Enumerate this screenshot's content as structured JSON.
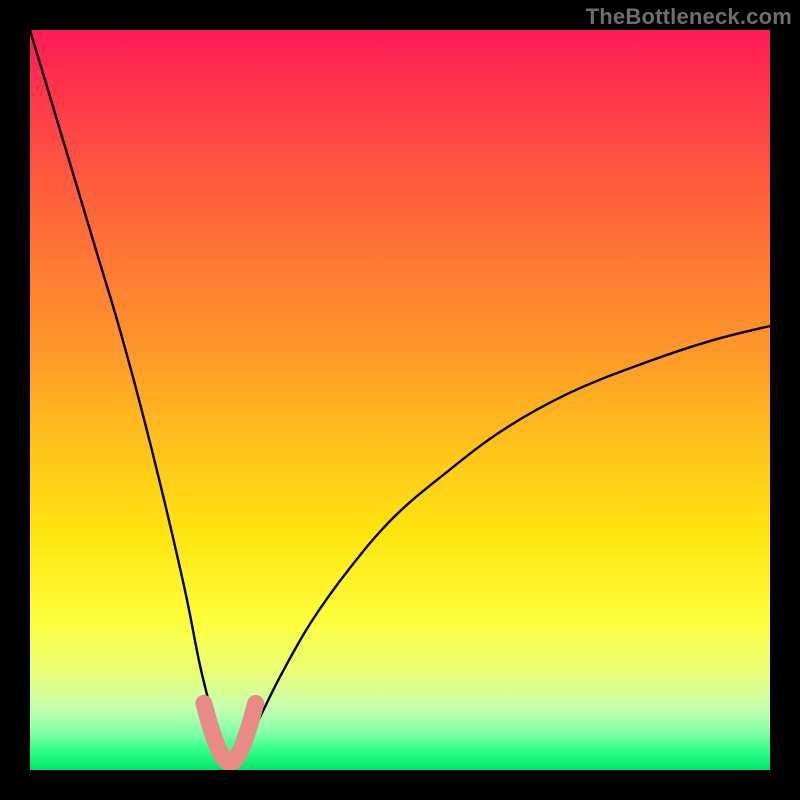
{
  "watermark": {
    "text": "TheBottleneck.com"
  },
  "colors": {
    "frame": "#000000",
    "curve": "#000000",
    "highlight": "#e98a86",
    "gradient_top": "#ff1a55",
    "gradient_bottom": "#00e66b"
  },
  "chart_data": {
    "type": "line",
    "title": "",
    "xlabel": "",
    "ylabel": "",
    "xlim": [
      0,
      100
    ],
    "ylim": [
      0,
      100
    ],
    "description": "Bottleneck curve: y ≈ |x − 27| shaped valley; minimum at x≈27 (y≈0), rising steeply to y≈100 at x≈0 and gradually to y≈60 at x≈100. Background gradient maps y≈0 → green, y≈100 → red.",
    "series": [
      {
        "name": "bottleneck-curve",
        "x": [
          0,
          3,
          6,
          9,
          12,
          15,
          18,
          21,
          23,
          25,
          26,
          27,
          28,
          29,
          31,
          34,
          38,
          43,
          49,
          56,
          64,
          73,
          83,
          92,
          100
        ],
        "y": [
          100,
          90,
          80,
          70,
          60,
          49,
          37,
          24,
          14,
          6,
          2,
          0,
          1,
          3,
          7,
          13,
          20,
          27,
          34,
          40,
          46,
          51,
          55,
          58,
          60
        ]
      },
      {
        "name": "highlight-segment",
        "x": [
          23.5,
          24.5,
          25.5,
          26.5,
          27.5,
          28.5,
          29.5,
          30.5
        ],
        "y": [
          9,
          5.5,
          2.8,
          1.2,
          1.2,
          2.8,
          5.5,
          9
        ]
      }
    ]
  }
}
